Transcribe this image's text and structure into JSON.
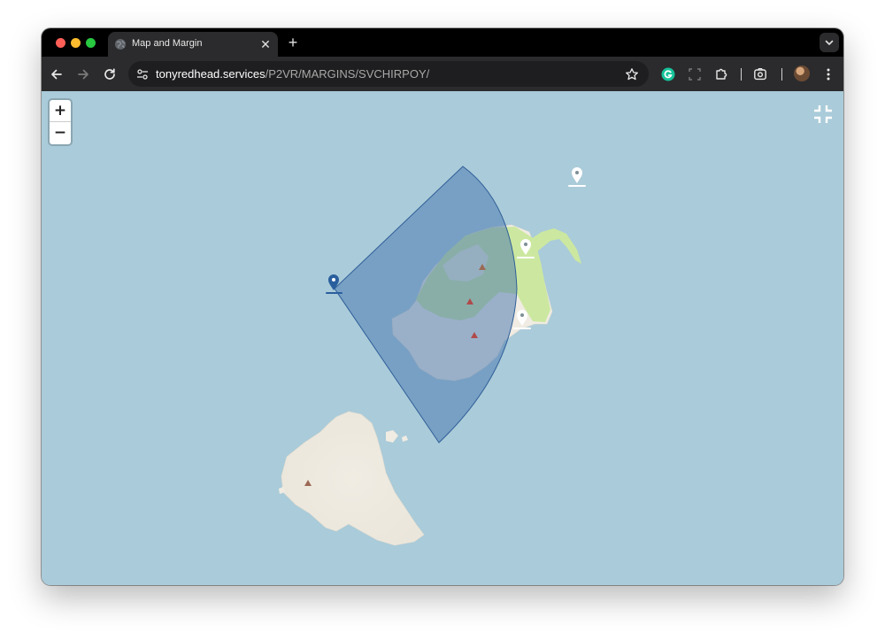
{
  "browser": {
    "tab_title": "Map and Margin",
    "tab_close_glyph": "✕",
    "new_tab_glyph": "+",
    "url_host": "tonyredhead.services",
    "url_path": "/P2VR/MARGINS/SVCHIRPOY/"
  },
  "map": {
    "zoom_in_label": "+",
    "zoom_out_label": "−",
    "sea_color": "#aacbd9",
    "land_color": "#f0ece3",
    "vegetation_color": "#cce8a0",
    "sector_fill_color": "#4a78b0",
    "selected_marker_color": "#2a5f9e",
    "markers": [
      {
        "id": "selected",
        "color": "#2a5f9e"
      },
      {
        "id": "marker-a",
        "color": "#ffffff"
      },
      {
        "id": "marker-b",
        "color": "#ffffff"
      },
      {
        "id": "marker-c",
        "color": "#ffffff"
      }
    ],
    "peaks": 4
  },
  "icons": {
    "back": "arrow-left-icon",
    "forward": "arrow-right-icon",
    "reload": "reload-icon",
    "site_info": "tune-icon",
    "bookmark": "star-icon",
    "grammarly": "grammarly-icon",
    "screenshot": "screenshot-icon",
    "extensions": "puzzle-icon",
    "lens": "lens-icon",
    "menu": "kebab-menu-icon",
    "fullscreen_exit": "fullscreen-exit-icon"
  }
}
